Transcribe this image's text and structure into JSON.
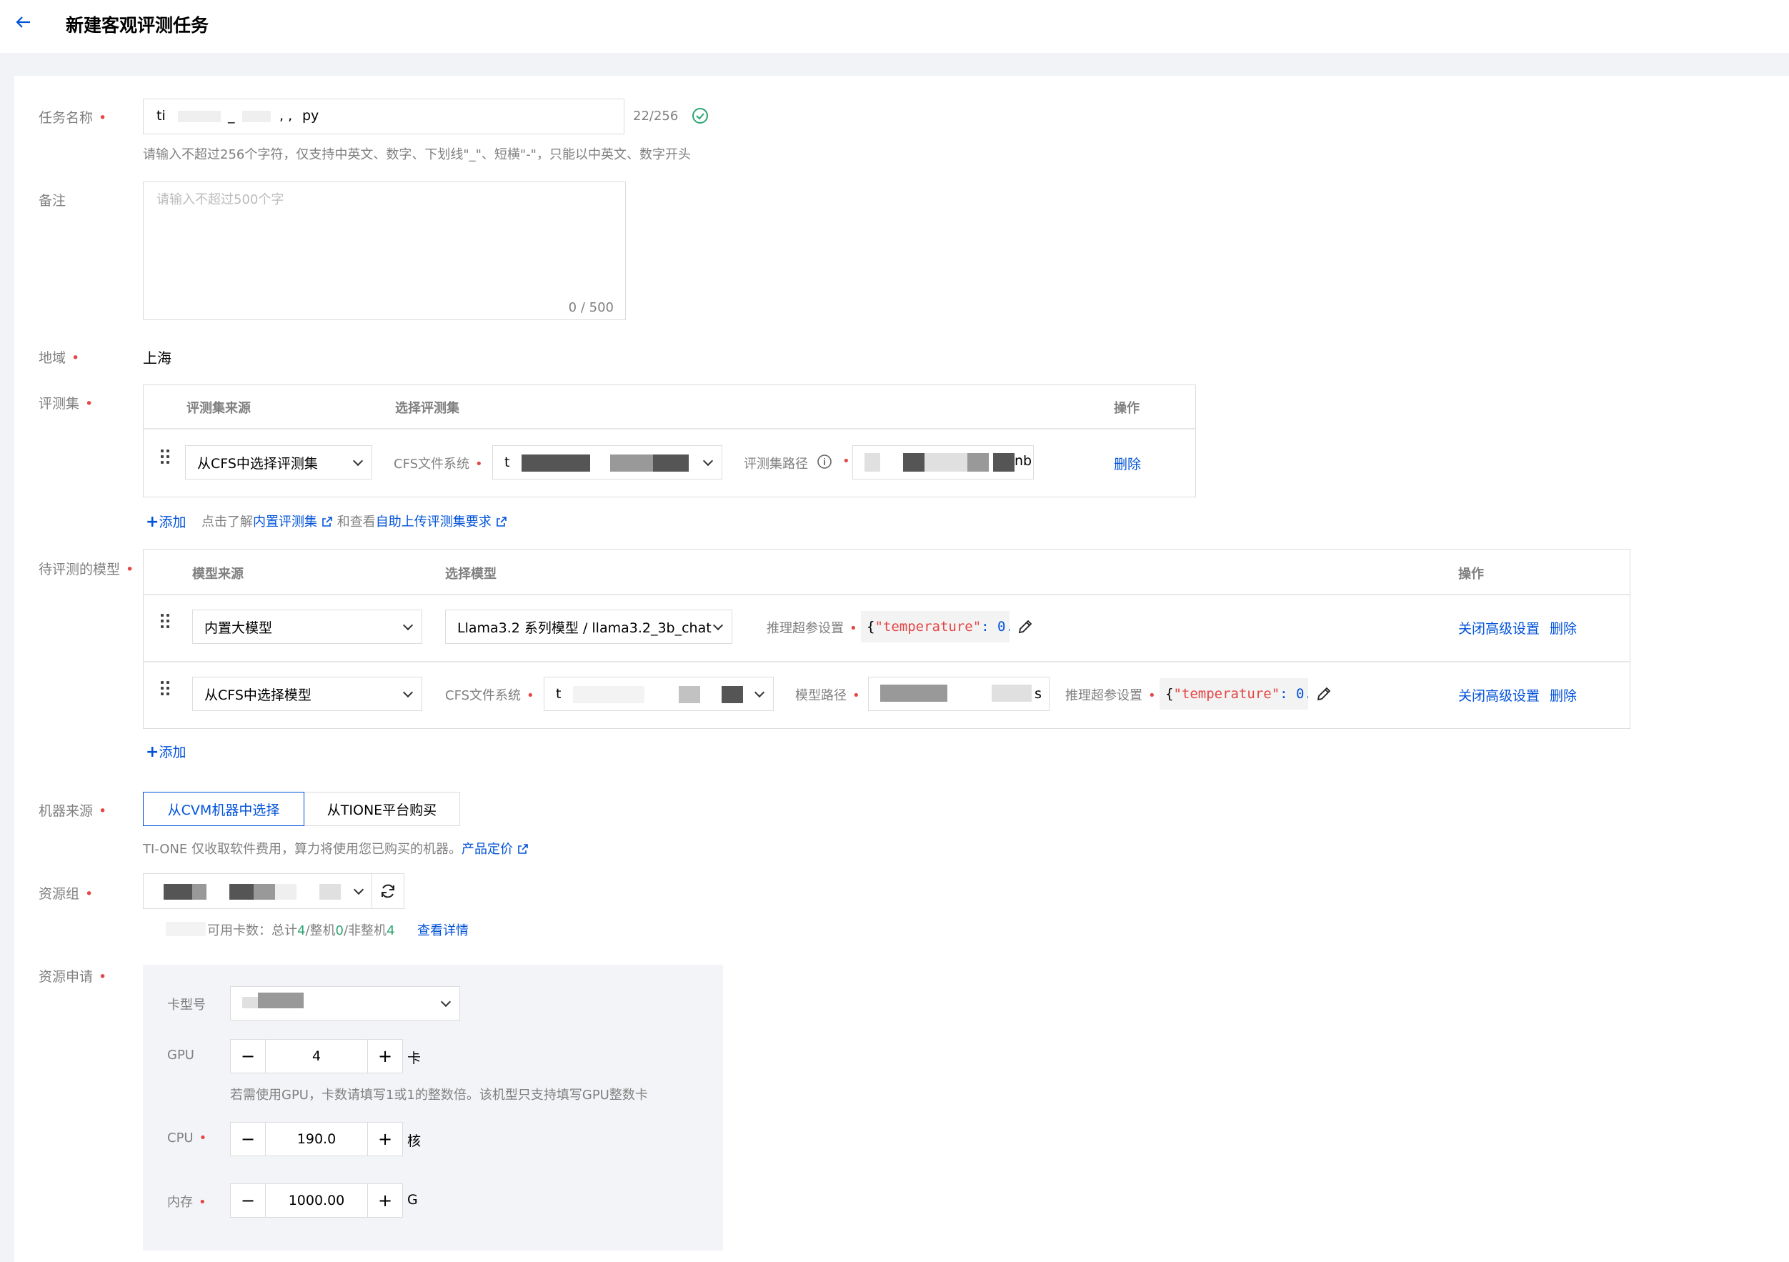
{
  "header": {
    "title": "新建客观评测任务"
  },
  "task_name": {
    "label": "任务名称",
    "value_prefix": "ti",
    "value_mid": "_",
    "value_mid2": ", ,",
    "value_suffix": "py",
    "counter": "22/256",
    "hint": "请输入不超过256个字符，仅支持中英文、数字、下划线\"_\"、短横\"-\"，只能以中英文、数字开头"
  },
  "remark": {
    "label": "备注",
    "placeholder": "请输入不超过500个字",
    "counter": "0 / 500"
  },
  "region": {
    "label": "地域",
    "value": "上海"
  },
  "eval_set": {
    "label": "评测集",
    "columns": [
      "评测集来源",
      "选择评测集",
      "操作"
    ],
    "row": {
      "source": "从CFS中选择评测集",
      "cfs_label": "CFS文件系统",
      "cfs_value_prefix": "t",
      "path_label": "评测集路径",
      "path_value_suffix": "nb",
      "delete": "删除"
    },
    "add": "添加",
    "note_prefix": "点击了解",
    "note_link1": "内置评测集",
    "note_mid": "和查看",
    "note_link2": "自助上传评测集要求"
  },
  "models": {
    "label": "待评测的模型",
    "columns": [
      "模型来源",
      "选择模型",
      "操作"
    ],
    "rows": [
      {
        "source": "内置大模型",
        "model": "Llama3.2 系列模型 / llama3.2_3b_chat",
        "param_label": "推理超参设置",
        "param_open": "{ ",
        "param_key": "\"temperature\"",
        "param_rest": ": 0....",
        "close_adv": "关闭高级设置",
        "delete": "删除"
      },
      {
        "source": "从CFS中选择模型",
        "cfs_label": "CFS文件系统",
        "cfs_value_prefix": "t",
        "path_label": "模型路径",
        "path_value_suffix": "s",
        "param_label": "推理超参设置",
        "param_open": "{ ",
        "param_key": "\"temperature\"",
        "param_rest": ": 0....",
        "close_adv": "关闭高级设置",
        "delete": "删除"
      }
    ],
    "add": "添加"
  },
  "machine": {
    "label": "机器来源",
    "options": [
      "从CVM机器中选择",
      "从TIONE平台购买"
    ],
    "selected": 0,
    "note": "TI-ONE 仅收取软件费用，算力将使用您已购买的机器。",
    "note_link": "产品定价"
  },
  "resource_group": {
    "label": "资源组",
    "avail_label": "可用卡数：总计",
    "total": "4",
    "sep1": "/整机",
    "whole": "0",
    "sep2": "/非整机",
    "partial": "4",
    "details": "查看详情"
  },
  "resource_request": {
    "label": "资源申请",
    "card_label": "卡型号",
    "gpu_label": "GPU",
    "gpu_value": "4",
    "gpu_unit": "卡",
    "gpu_hint": "若需使用GPU，卡数请填写1或1的整数倍。该机型只支持填写GPU整数卡",
    "cpu_label": "CPU",
    "cpu_value": "190.0",
    "cpu_unit": "核",
    "mem_label": "内存",
    "mem_value": "1000.00",
    "mem_unit": "G",
    "minus": "−",
    "plus": "+"
  },
  "colors": {
    "accent": "#0052d9",
    "required": "#e54545",
    "success": "#2ba471"
  },
  "icons": [
    "arrow-left-icon",
    "check-circle-icon",
    "drag-handle-icon",
    "info-icon",
    "external-link-icon",
    "edit-pencil-icon",
    "refresh-icon",
    "chevron-down-icon",
    "plus-icon"
  ]
}
